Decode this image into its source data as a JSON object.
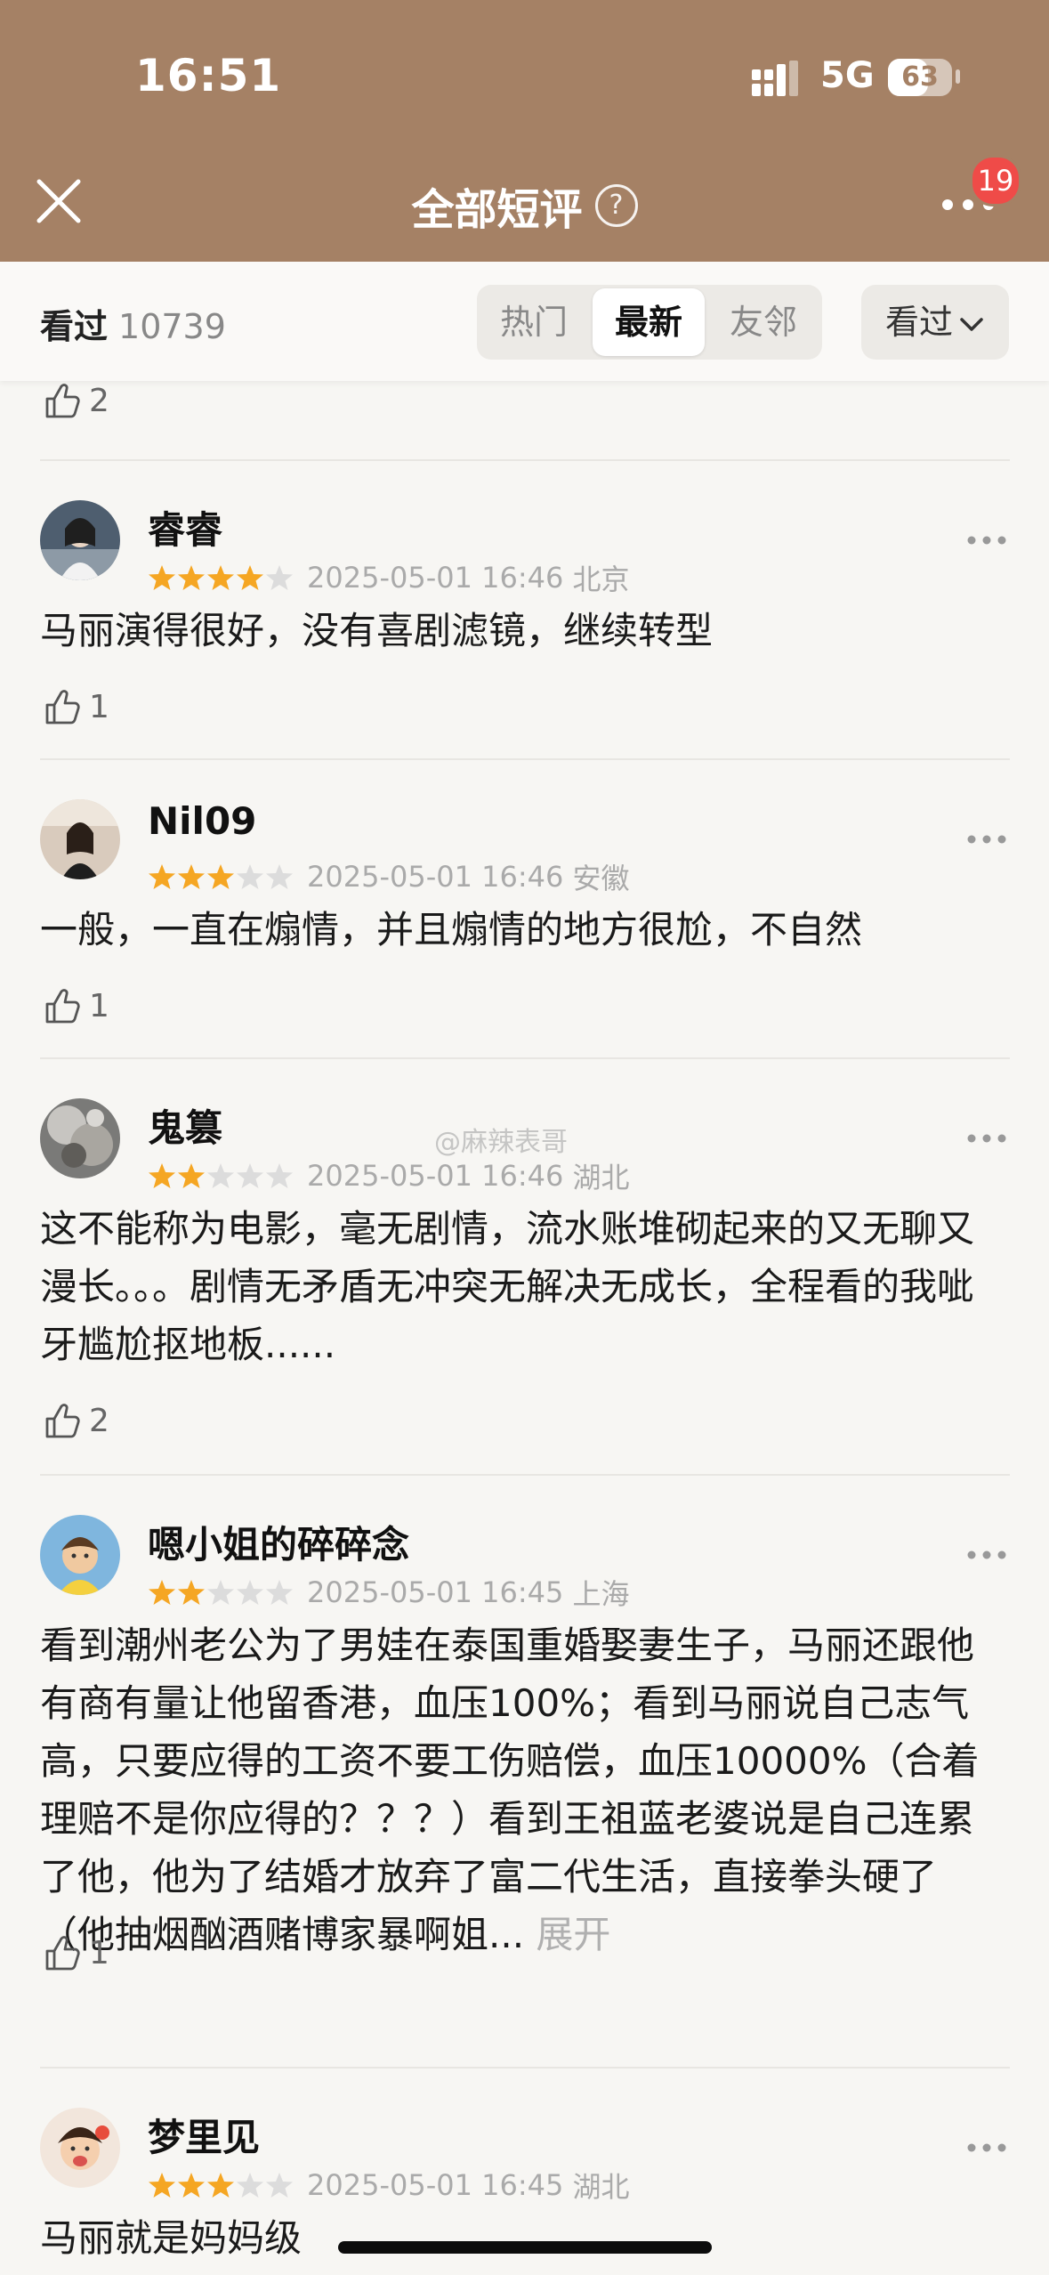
{
  "status_bar": {
    "time": "16:51",
    "network": "5G",
    "battery": "63",
    "battery_level": 0.63
  },
  "nav": {
    "title": "全部短评",
    "help_glyph": "?",
    "notification_count": "19"
  },
  "filter_bar": {
    "seen_label": "看过",
    "seen_count": "10739",
    "tabs": [
      "热门",
      "最新",
      "友邻"
    ],
    "active_tab": "最新",
    "dropdown_label": "看过"
  },
  "top_partial": {
    "likes": "2"
  },
  "reviews": [
    {
      "user": "睿睿",
      "rating": 4,
      "time": "2025-05-01 16:46",
      "location": "北京",
      "text": "马丽演得很好，没有喜剧滤镜，继续转型",
      "likes": "1"
    },
    {
      "user": "Nil09",
      "rating": 3,
      "time": "2025-05-01 16:46",
      "location": "安徽",
      "text": "一般，一直在煽情，并且煽情的地方很尬，不自然",
      "likes": "1"
    },
    {
      "user": "鬼篡",
      "rating": 2,
      "time": "2025-05-01 16:46",
      "location": "湖北",
      "text": "这不能称为电影，毫无剧情，流水账堆砌起来的又无聊又漫长。。。剧情无矛盾无冲突无解决无成长，全程看的我呲牙尴尬抠地板......",
      "likes": "2"
    },
    {
      "user": "嗯小姐的碎碎念",
      "rating": 2,
      "time": "2025-05-01 16:45",
      "location": "上海",
      "text": "看到潮州老公为了男娃在泰国重婚娶妻生子，马丽还跟他有商有量让他留香港，血压100%；看到马丽说自己志气高，只要应得的工资不要工伤赔偿，血压10000%（合着理赔不是你应得的？？？）看到王祖蓝老婆说是自己连累了他，他为了结婚才放弃了富二代生活，直接拳头硬了（他抽烟酗酒赌博家暴啊姐...",
      "expand": "展开",
      "likes": "1"
    },
    {
      "user": "梦里见",
      "rating": 3,
      "time": "2025-05-01 16:45",
      "location": "湖北",
      "text": "马丽就是妈妈级"
    }
  ],
  "watermark": "@麻辣表哥",
  "colors": {
    "header_bg": "#a58165",
    "star_on": "#f5a623",
    "star_off": "#dcdcdc",
    "badge": "#ef4b48"
  },
  "icons": [
    "close-icon",
    "help-icon",
    "more-icon",
    "thumbs-up-icon",
    "chevron-down-icon",
    "star-icon"
  ]
}
